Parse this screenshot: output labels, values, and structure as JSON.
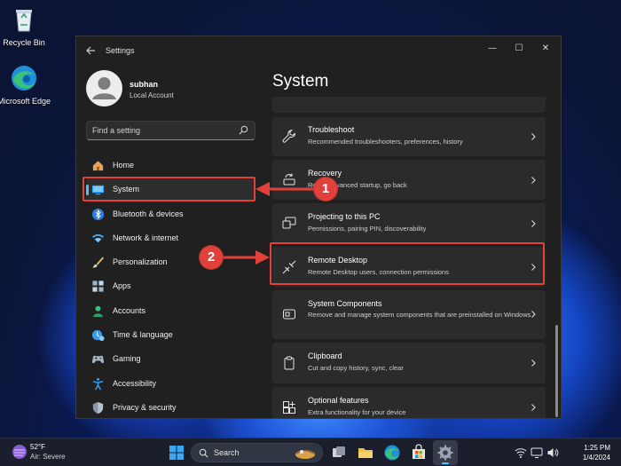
{
  "desktop": {
    "icons": [
      {
        "label": "Recycle Bin",
        "icon": "recycle-bin-icon"
      },
      {
        "label": "Microsoft Edge",
        "icon": "edge-icon"
      }
    ]
  },
  "window": {
    "title": "Settings",
    "controls": {
      "minimize": "—",
      "maximize": "☐",
      "close": "✕"
    }
  },
  "profile": {
    "name": "subhan",
    "account_type": "Local Account"
  },
  "search": {
    "placeholder": "Find a setting"
  },
  "nav": {
    "items": [
      {
        "label": "Home",
        "icon": "home-icon"
      },
      {
        "label": "System",
        "icon": "system-icon",
        "selected": true
      },
      {
        "label": "Bluetooth & devices",
        "icon": "bluetooth-icon"
      },
      {
        "label": "Network & internet",
        "icon": "network-icon"
      },
      {
        "label": "Personalization",
        "icon": "brush-icon"
      },
      {
        "label": "Apps",
        "icon": "apps-icon"
      },
      {
        "label": "Accounts",
        "icon": "accounts-icon"
      },
      {
        "label": "Time & language",
        "icon": "time-language-icon"
      },
      {
        "label": "Gaming",
        "icon": "gaming-icon"
      },
      {
        "label": "Accessibility",
        "icon": "accessibility-icon"
      },
      {
        "label": "Privacy & security",
        "icon": "shield-icon"
      }
    ]
  },
  "main": {
    "title": "System",
    "cards": [
      {
        "title": "Troubleshoot",
        "desc": "Recommended troubleshooters, preferences, history",
        "icon": "wrench-icon"
      },
      {
        "title": "Recovery",
        "desc": "Reset, advanced startup, go back",
        "icon": "recovery-icon"
      },
      {
        "title": "Projecting to this PC",
        "desc": "Permissions, pairing PIN, discoverability",
        "icon": "projecting-icon"
      },
      {
        "title": "Remote Desktop",
        "desc": "Remote Desktop users, connection permissions",
        "icon": "remote-desktop-icon"
      },
      {
        "title": "System Components",
        "desc": "Remove and manage system components that are preinstalled on Windows",
        "icon": "system-components-icon"
      },
      {
        "title": "Clipboard",
        "desc": "Cut and copy history, sync, clear",
        "icon": "clipboard-icon"
      },
      {
        "title": "Optional features",
        "desc": "Extra functionality for your device",
        "icon": "optional-features-icon"
      }
    ]
  },
  "callouts": {
    "step1": "1",
    "step2": "2"
  },
  "taskbar": {
    "weather_temp": "52°F",
    "weather_desc": "Air: Severe",
    "search_label": "Search",
    "time": "1:25 PM",
    "date": "1/4/2024"
  },
  "colors": {
    "accent": "#4cc2ff",
    "highlight": "#e2403b",
    "window_bg": "#202020",
    "card_bg": "#2b2b2b"
  }
}
